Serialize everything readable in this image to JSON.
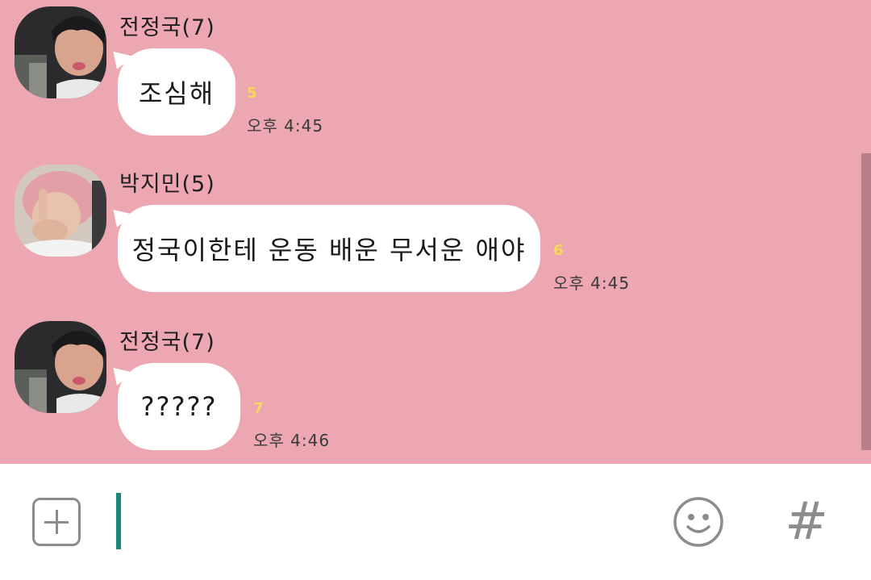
{
  "messages": [
    {
      "sender": "전정국(7)",
      "text": "조심해",
      "unread": "5",
      "time": "오후 4:45"
    },
    {
      "sender": "박지민(5)",
      "text": "정국이한테 운동 배운 무서운 애야",
      "unread": "6",
      "time": "오후 4:45"
    },
    {
      "sender": "전정국(7)",
      "text": "?????",
      "unread": "7",
      "time": "오후 4:46"
    }
  ],
  "input": {
    "value": ""
  },
  "icons": {
    "attach": "plus-icon",
    "emoticon": "smiley-icon",
    "hashtag": "#"
  },
  "colors": {
    "chat_background": "#eca7b1",
    "bubble": "#ffffff",
    "unread_count": "#f7d85c",
    "caret": "#1a8a78",
    "icon_gray": "#8c8c8c"
  }
}
